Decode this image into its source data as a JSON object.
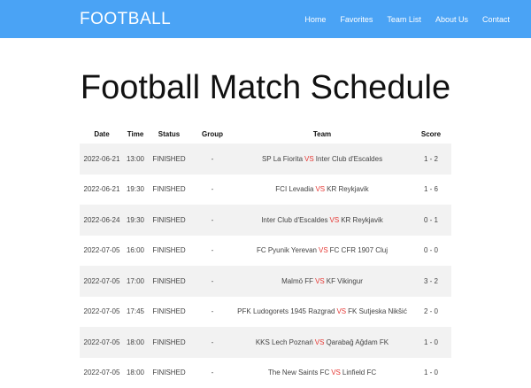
{
  "navbar": {
    "brand": "FOOTBALL",
    "links": [
      "Home",
      "Favorites",
      "Team List",
      "About Us",
      "Contact"
    ]
  },
  "page_title": "Football Match Schedule",
  "table": {
    "headers": [
      "Date",
      "Time",
      "Status",
      "Group",
      "Team",
      "Score"
    ],
    "vs_label": "VS",
    "rows": [
      {
        "date": "2022-06-21",
        "time": "13:00",
        "status": "FINISHED",
        "group": "-",
        "home": "SP La Fiorita",
        "away": "Inter Club d'Escaldes",
        "score": "1 - 2"
      },
      {
        "date": "2022-06-21",
        "time": "19:30",
        "status": "FINISHED",
        "group": "-",
        "home": "FCI Levadia",
        "away": "KR Reykjavik",
        "score": "1 - 6"
      },
      {
        "date": "2022-06-24",
        "time": "19:30",
        "status": "FINISHED",
        "group": "-",
        "home": "Inter Club d'Escaldes",
        "away": "KR Reykjavik",
        "score": "0 - 1"
      },
      {
        "date": "2022-07-05",
        "time": "16:00",
        "status": "FINISHED",
        "group": "-",
        "home": "FC Pyunik Yerevan",
        "away": "FC CFR 1907 Cluj",
        "score": "0 - 0"
      },
      {
        "date": "2022-07-05",
        "time": "17:00",
        "status": "FINISHED",
        "group": "-",
        "home": "Malmö FF",
        "away": "KF Vikingur",
        "score": "3 - 2"
      },
      {
        "date": "2022-07-05",
        "time": "17:45",
        "status": "FINISHED",
        "group": "-",
        "home": "PFK Ludogorets 1945 Razgrad",
        "away": "FK Sutjeska Nikšić",
        "score": "2 - 0"
      },
      {
        "date": "2022-07-05",
        "time": "18:00",
        "status": "FINISHED",
        "group": "-",
        "home": "KKS Lech Poznań",
        "away": "Qarabağ Ağdam FK",
        "score": "1 - 0"
      },
      {
        "date": "2022-07-05",
        "time": "18:00",
        "status": "FINISHED",
        "group": "-",
        "home": "The New Saints FC",
        "away": "Linfield FC",
        "score": "1 - 0"
      }
    ]
  }
}
